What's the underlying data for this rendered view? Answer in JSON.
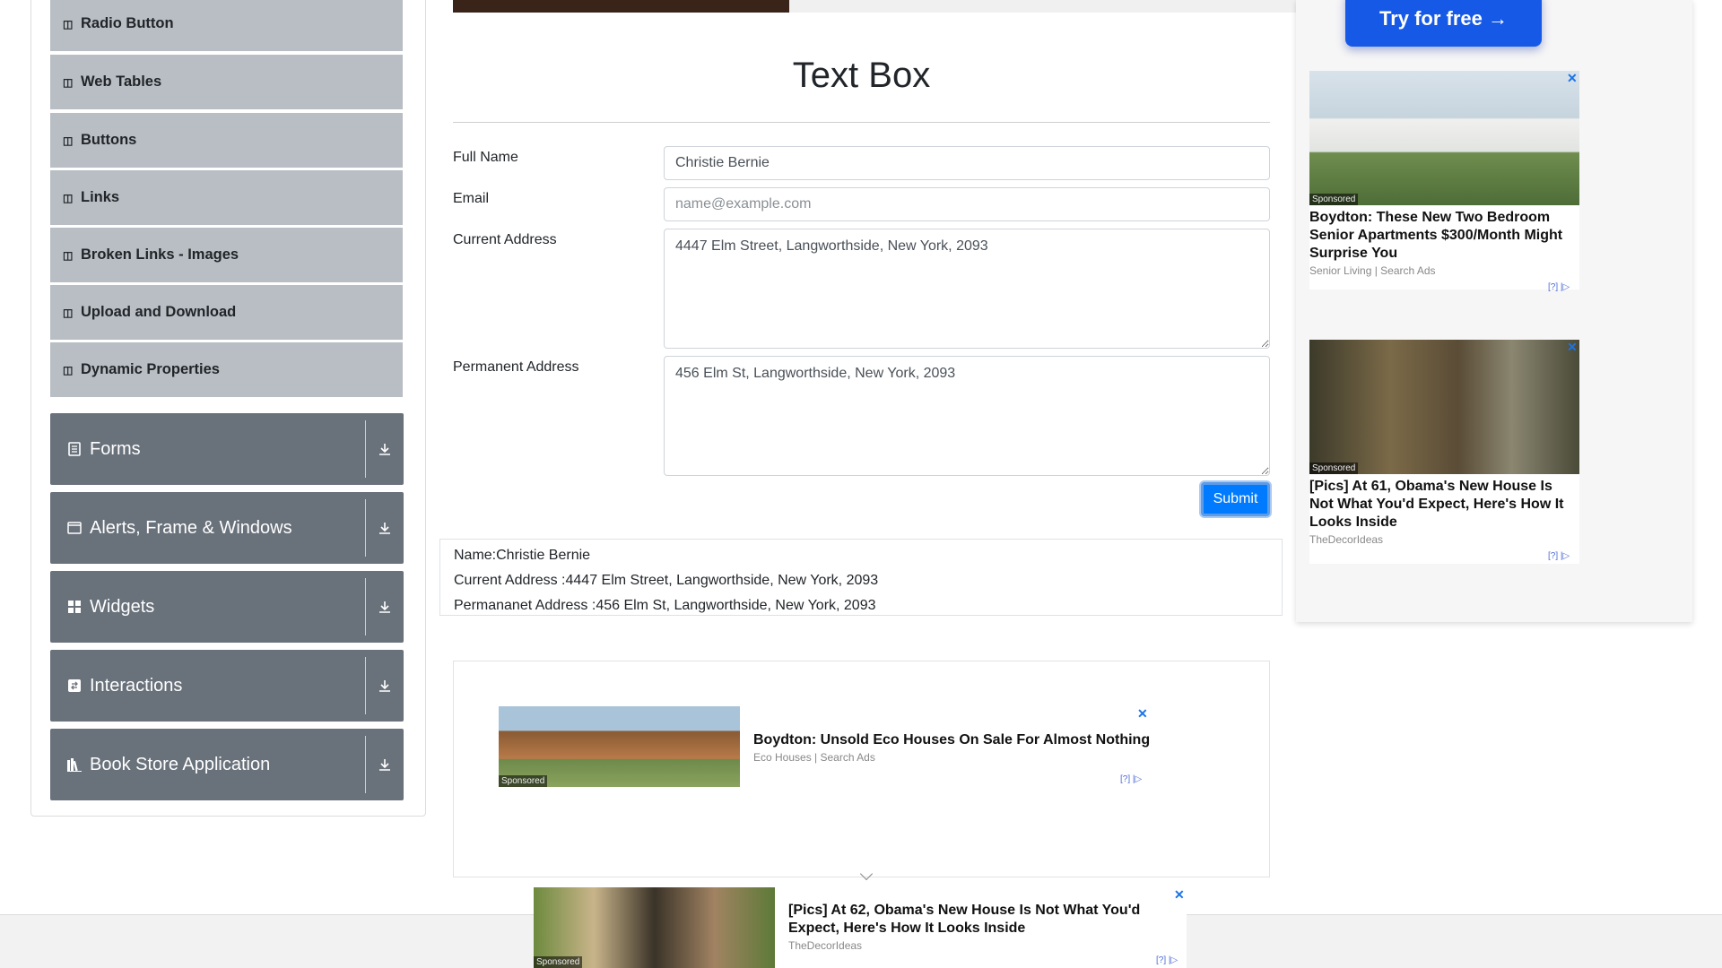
{
  "sidebar": {
    "sub_items": [
      {
        "label": "Radio Button",
        "icon": "book-icon"
      },
      {
        "label": "Web Tables",
        "icon": "book-icon"
      },
      {
        "label": "Buttons",
        "icon": "book-icon"
      },
      {
        "label": "Links",
        "icon": "book-icon"
      },
      {
        "label": "Broken Links - Images",
        "icon": "book-icon"
      },
      {
        "label": "Upload and Download",
        "icon": "book-icon"
      },
      {
        "label": "Dynamic Properties",
        "icon": "book-icon"
      }
    ],
    "groups": [
      {
        "label": "Forms",
        "icon": "file-icon"
      },
      {
        "label": "Alerts, Frame & Windows",
        "icon": "window-icon"
      },
      {
        "label": "Widgets",
        "icon": "grid-icon"
      },
      {
        "label": "Interactions",
        "icon": "interaction-icon"
      },
      {
        "label": "Book Store Application",
        "icon": "books-icon"
      }
    ]
  },
  "main": {
    "title": "Text Box",
    "form": {
      "full_name_label": "Full Name",
      "full_name_value": "Christie Bernie",
      "email_label": "Email",
      "email_placeholder": "name@example.com",
      "current_address_label": "Current Address",
      "current_address_value": "4447 Elm Street, Langworthside, New York, 2093",
      "permanent_address_label": "Permanent Address",
      "permanent_address_value": "456 Elm St, Langworthside, New York, 2093",
      "submit_label": "Submit"
    },
    "output": {
      "name": "Name:Christie Bernie",
      "current_address": "Current Address :4447 Elm Street, Langworthside, New York, 2093",
      "permanent_address": "Permananet Address :456 Elm St, Langworthside, New York, 2093"
    }
  },
  "ads": {
    "try_button": "Try for free →",
    "sponsored": "Sponsored",
    "close": "✕",
    "choices": "[?] |▷",
    "cards": [
      {
        "title": "Boydton: These New Two Bedroom Senior Apartments $300/Month Might Surprise You",
        "source": "Senior Living | Search Ads"
      },
      {
        "title": "[Pics] At 61, Obama's New House Is Not What You'd Expect, Here's How It Looks Inside",
        "source": "TheDecorIdeas"
      }
    ],
    "inline": {
      "title": "Boydton: Unsold Eco Houses On Sale For Almost Nothing",
      "source": "Eco Houses | Search Ads"
    },
    "bottom": {
      "title": "[Pics] At 62, Obama's New House Is Not What You'd Expect, Here's How It Looks Inside",
      "source": "TheDecorIdeas"
    }
  },
  "colors": {
    "sidebar_group": "#69717b",
    "sidebar_sub": "#b8bec4",
    "primary": "#007bff"
  }
}
